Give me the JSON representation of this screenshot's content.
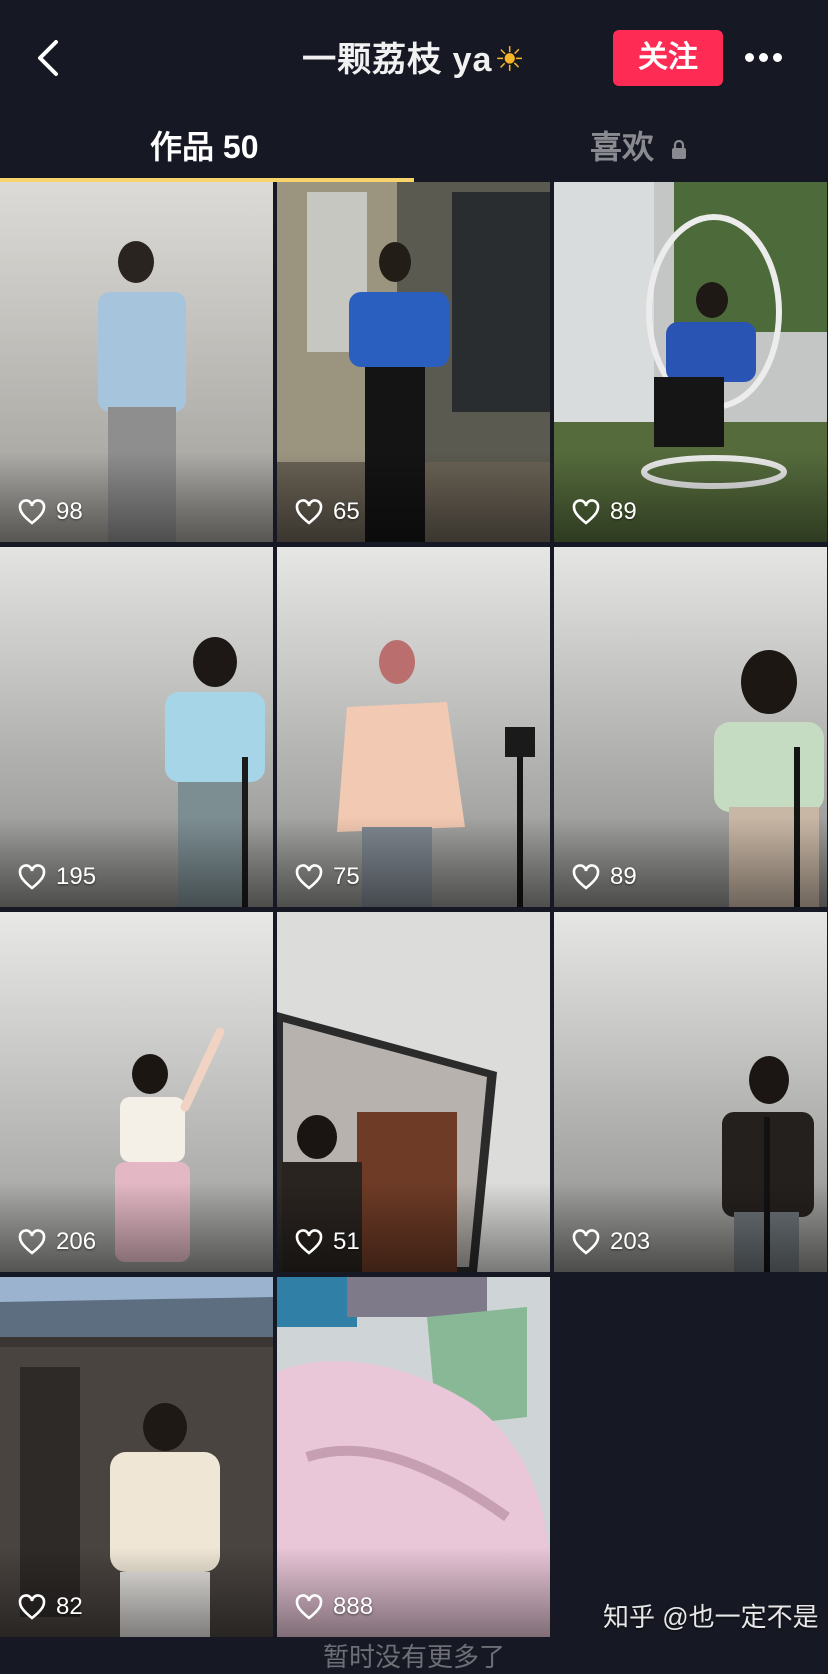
{
  "header": {
    "title": "一颗荔枝 ya",
    "title_emoji": "☀",
    "follow_label": "关注"
  },
  "tabs": {
    "works_label": "作品 50",
    "likes_label": "喜欢"
  },
  "videos": [
    {
      "likes": "98"
    },
    {
      "likes": "65"
    },
    {
      "likes": "89"
    },
    {
      "likes": "195"
    },
    {
      "likes": "75"
    },
    {
      "likes": "89"
    },
    {
      "likes": "206"
    },
    {
      "likes": "51"
    },
    {
      "likes": "203"
    },
    {
      "likes": "82"
    },
    {
      "likes": "888"
    }
  ],
  "footer_text": "暂时没有更多了",
  "watermark": "知乎 @也一定不是",
  "colors": {
    "background": "#161823",
    "follow_button": "#fe2c55",
    "tab_indicator": "#f7d36b"
  }
}
